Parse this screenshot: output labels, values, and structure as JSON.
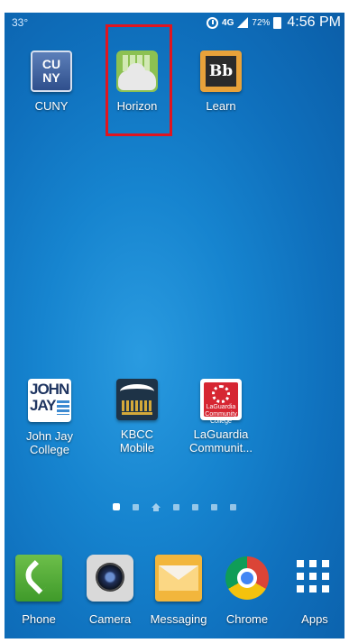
{
  "status_bar": {
    "temperature": "33°",
    "network": "4G",
    "battery_percent": "72%",
    "time": "4:56 PM",
    "icons": [
      "alarm-icon",
      "signal-icon",
      "battery-icon"
    ]
  },
  "home_apps": [
    {
      "label": "CUNY",
      "icon": "cuny-icon",
      "logo_text": [
        "CU",
        "NY"
      ]
    },
    {
      "label": "Horizon",
      "icon": "horizon-icon"
    },
    {
      "label": "Learn",
      "icon": "blackboard-learn-icon",
      "logo_text": "Bb"
    },
    {
      "label": "John Jay\nCollege",
      "icon": "john-jay-icon",
      "logo_text": [
        "JOHN",
        "JAY"
      ]
    },
    {
      "label": "KBCC\nMobile",
      "icon": "kbcc-icon"
    },
    {
      "label": "LaGuardia\nCommunit...",
      "icon": "laguardia-icon",
      "logo_text": "LaGuardia\nCommunity College"
    }
  ],
  "page_indicator": {
    "count": 7,
    "active_index": 0,
    "home_index": 2
  },
  "dock": [
    {
      "label": "Phone",
      "icon": "phone-icon"
    },
    {
      "label": "Camera",
      "icon": "camera-icon"
    },
    {
      "label": "Messaging",
      "icon": "messaging-icon"
    },
    {
      "label": "Chrome",
      "icon": "chrome-icon"
    },
    {
      "label": "Apps",
      "icon": "apps-grid-icon"
    }
  ],
  "colors": {
    "wallpaper": "#1684cf",
    "highlight_box": "#e0151f"
  }
}
